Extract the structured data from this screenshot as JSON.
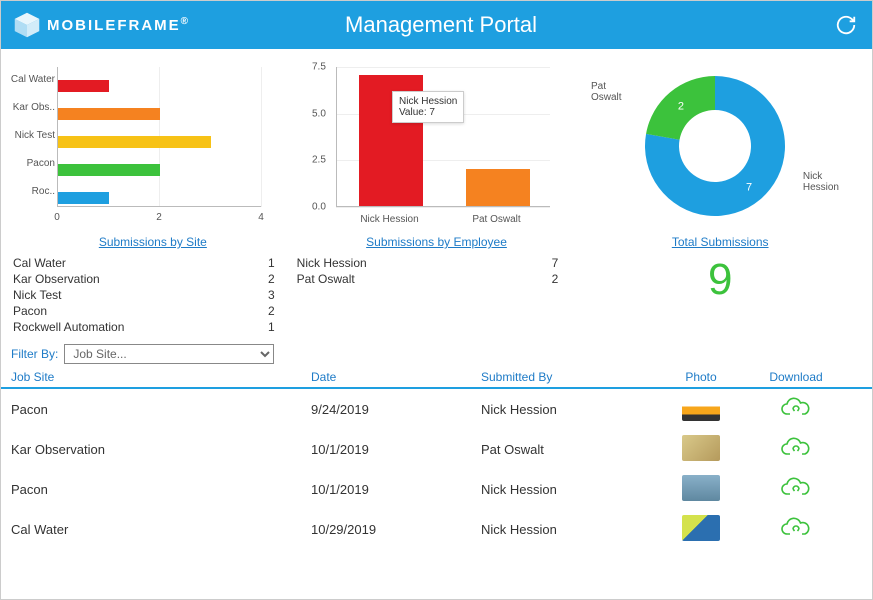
{
  "header": {
    "brand": "MOBILEFRAME",
    "title": "Management Portal"
  },
  "chart_data": [
    {
      "type": "bar",
      "orientation": "horizontal",
      "categories": [
        "Cal Water",
        "Kar Obs..",
        "Nick Test",
        "Pacon",
        "Roc.."
      ],
      "values": [
        1,
        2,
        3,
        2,
        1
      ],
      "colors": [
        "#e31b23",
        "#f58220",
        "#f7c216",
        "#3cc23c",
        "#1e9fe0"
      ],
      "xlim": [
        0,
        4
      ],
      "xticks": [
        0,
        2,
        4
      ]
    },
    {
      "type": "bar",
      "orientation": "vertical",
      "categories": [
        "Nick Hession",
        "Pat Oswalt"
      ],
      "values": [
        7,
        2
      ],
      "colors": [
        "#e31b23",
        "#f58220"
      ],
      "ylim": [
        0,
        7.5
      ],
      "yticks": [
        0.0,
        2.5,
        5.0,
        7.5
      ],
      "tooltip": {
        "name": "Nick Hession",
        "value": 7
      }
    },
    {
      "type": "pie",
      "donut": true,
      "slices": [
        {
          "label": "Nick Hession",
          "value": 7,
          "color": "#1e9fe0"
        },
        {
          "label": "Pat Oswalt",
          "value": 2,
          "color": "#3cc23c"
        }
      ]
    }
  ],
  "sections": {
    "by_site_label": "Submissions by Site",
    "by_employee_label": "Submissions by Employee",
    "total_label": "Total Submissions"
  },
  "by_site": [
    {
      "name": "Cal Water",
      "count": 1
    },
    {
      "name": "Kar Observation",
      "count": 2
    },
    {
      "name": "Nick Test",
      "count": 3
    },
    {
      "name": "Pacon",
      "count": 2
    },
    {
      "name": "Rockwell Automation",
      "count": 1
    }
  ],
  "by_employee": [
    {
      "name": "Nick Hession",
      "count": 7
    },
    {
      "name": "Pat Oswalt",
      "count": 2
    }
  ],
  "total_submissions": 9,
  "filter": {
    "label": "Filter By:",
    "placeholder": "Job Site..."
  },
  "table": {
    "columns": {
      "jobsite": "Job Site",
      "date": "Date",
      "submitted": "Submitted By",
      "photo": "Photo",
      "download": "Download"
    },
    "rows": [
      {
        "jobsite": "Pacon",
        "date": "9/24/2019",
        "submitted": "Nick Hession",
        "thumb": "linear-gradient(180deg,#fff 45%,#f7a61b 45%,#f7a61b 75%,#333 75%)"
      },
      {
        "jobsite": "Kar Observation",
        "date": "10/1/2019",
        "submitted": "Pat Oswalt",
        "thumb": "linear-gradient(135deg,#d9c98a,#b59a5c)"
      },
      {
        "jobsite": "Pacon",
        "date": "10/1/2019",
        "submitted": "Nick Hession",
        "thumb": "linear-gradient(180deg,#89b0c9,#5f88a0)"
      },
      {
        "jobsite": "Cal Water",
        "date": "10/29/2019",
        "submitted": "Nick Hession",
        "thumb": "linear-gradient(135deg,#d4e24c 40%,#2b6fb0 40%)"
      }
    ]
  }
}
